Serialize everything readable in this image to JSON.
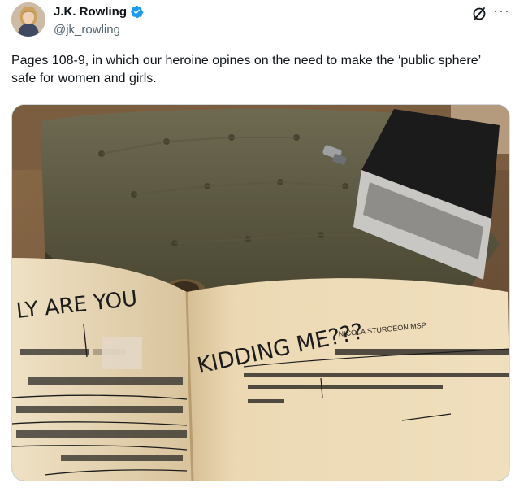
{
  "author": {
    "display_name": "J.K. Rowling",
    "handle": "@jk_rowling",
    "verified": true
  },
  "icons": {
    "verified": "verified-badge-icon",
    "grok": "grok-icon",
    "more": "more-options-icon"
  },
  "tweet": {
    "text": "Pages 108-9, in which our heroine opines on the need to make the ‘public sphere’ safe for women and girls."
  },
  "media": {
    "handwriting_left": "LY ARE YOU",
    "handwriting_right": "KIDDING ME???",
    "book_inscription": "NICOLA STURGEON MSP"
  },
  "colors": {
    "name": "#0f1419",
    "secondary": "#536471",
    "verified": "#1d9bf0"
  }
}
